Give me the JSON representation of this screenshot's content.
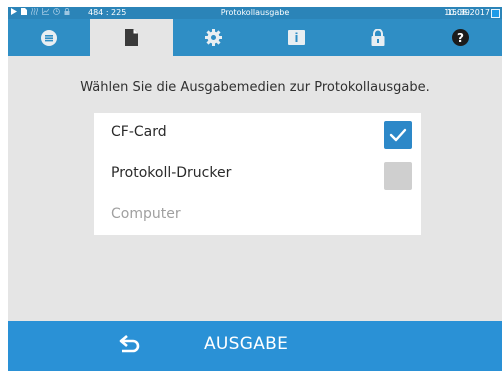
{
  "status_bar": {
    "coords": "484 : 225",
    "title": "Protokollausgabe",
    "time": "15:39",
    "date": "10.08.2017"
  },
  "tabs": [
    {
      "icon": "database-icon",
      "active": false
    },
    {
      "icon": "document-icon",
      "active": true
    },
    {
      "icon": "gear-icon",
      "active": false
    },
    {
      "icon": "info-tablet-icon",
      "active": false
    },
    {
      "icon": "lock-icon",
      "active": false
    },
    {
      "icon": "help-icon",
      "active": false
    }
  ],
  "prompt": "Wählen Sie die Ausgabemedien zur Protokollausgabe.",
  "options": [
    {
      "label": "CF-Card",
      "checked": true,
      "enabled": true
    },
    {
      "label": "Protokoll-Drucker",
      "checked": false,
      "enabled": true
    },
    {
      "label": "Computer",
      "checked": false,
      "enabled": false
    }
  ],
  "action_bar": {
    "label": "AUSGABE",
    "back_icon": "back-arrow-icon"
  },
  "colors": {
    "tab_bar": "#2f8ec5",
    "action_bar": "#2a91d6",
    "checkbox_checked": "#2d88c8",
    "checkbox_unchecked": "#cfcfcf",
    "background": "#e5e5e5"
  }
}
